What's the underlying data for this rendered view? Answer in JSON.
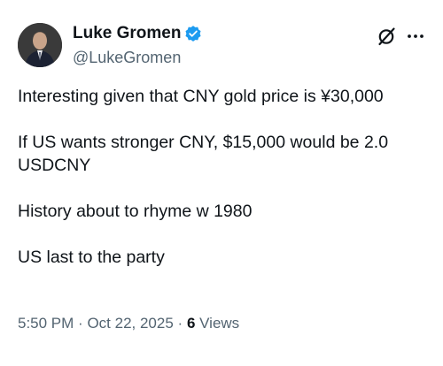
{
  "author": {
    "display_name": "Luke Gromen",
    "handle": "@LukeGromen",
    "verified": true
  },
  "tweet": {
    "paragraphs": [
      "Interesting given that CNY gold price is ¥30,000",
      "If US wants stronger CNY, $15,000 would be 2.0 USDCNY",
      "History about to rhyme w 1980",
      "US last to the party"
    ]
  },
  "meta": {
    "time": "5:50 PM",
    "separator": "·",
    "date": "Oct 22, 2025",
    "views_count": "6",
    "views_label": "Views"
  },
  "icons": {
    "verified": "verified-badge-icon",
    "grok": "grok-icon",
    "more": "more-options-icon"
  },
  "colors": {
    "text": "#0f1419",
    "secondary": "#536471",
    "verified": "#1d9bf0"
  }
}
